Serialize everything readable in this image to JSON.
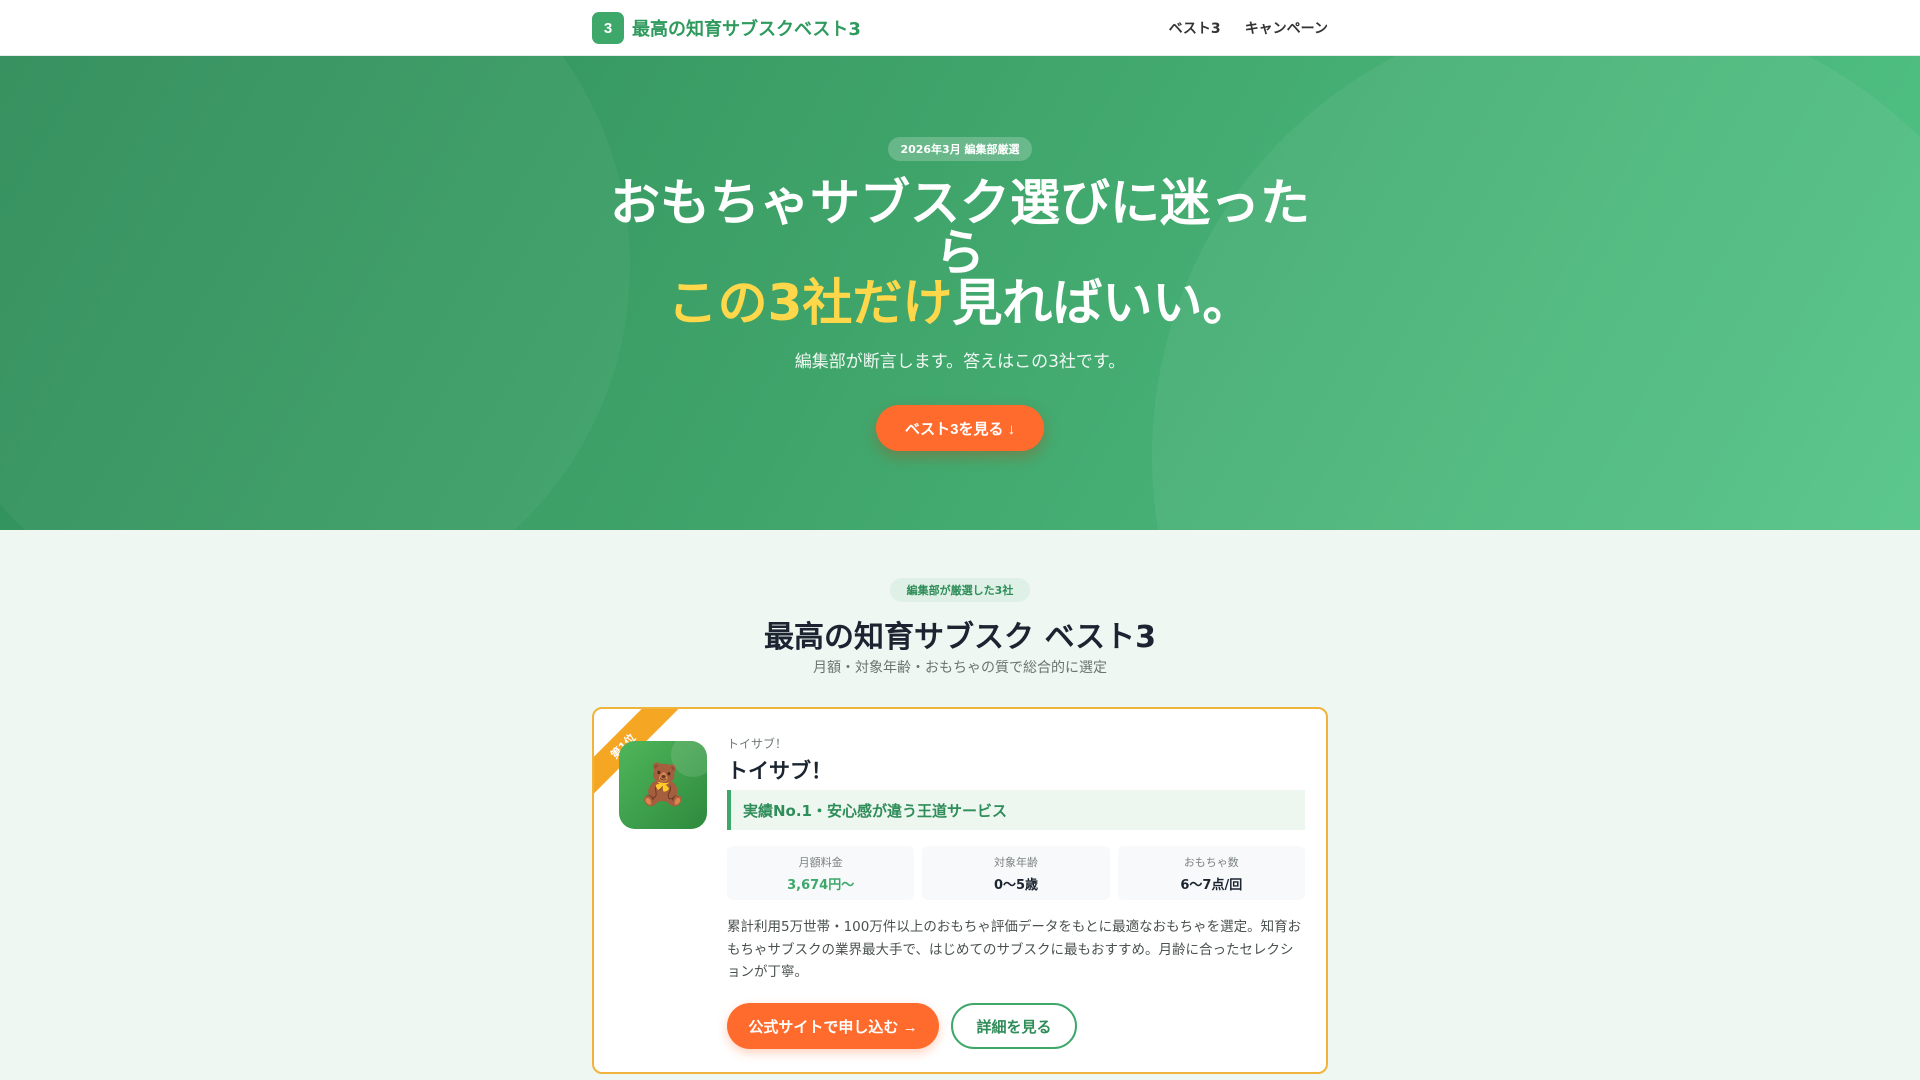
{
  "header": {
    "badge": "3",
    "site_name": "最高の知育サブスクベスト3",
    "nav": [
      {
        "label": "ベスト3"
      },
      {
        "label": "キャンペーン"
      }
    ]
  },
  "hero": {
    "badge": "2026年3月 編集部厳選",
    "title_line1": "おもちゃサブスク選びに迷ったら",
    "title_highlight": "この3社だけ",
    "title_rest": "見ればいい。",
    "subtitle": "編集部が断言します。答えはこの3社です。",
    "cta_label": "ベスト3を見る ↓"
  },
  "ranking": {
    "pill": "編集部が厳選した3社",
    "title": "最高の知育サブスク ベスト3",
    "subtitle": "月額・対象年齢・おもちゃの質で総合的に選定",
    "items": [
      {
        "rank_label": "第1位",
        "logo_icon": "🧸",
        "brand": "トイサブ！",
        "name": "トイサブ！",
        "tagline": "実績No.1・安心感が違う王道サービス",
        "stats": [
          {
            "label": "月額料金",
            "value": "3,674円〜"
          },
          {
            "label": "対象年齢",
            "value": "0〜5歳"
          },
          {
            "label": "おもちゃ数",
            "value": "6〜7点/回"
          }
        ],
        "description": "累計利用5万世帯・100万件以上のおもちゃ評価データをもとに最適なおもちゃを選定。知育おもちゃサブスクの業界最大手で、はじめてのサブスクに最もおすすめ。月齢に合ったセレクションが丁寧。",
        "primary_cta": "公式サイトで申し込む →",
        "secondary_cta": "詳細を見る"
      }
    ]
  },
  "colors": {
    "brand_green": "#3ea86a",
    "accent_orange": "#ff6b2c",
    "highlight_yellow": "#ffd74a",
    "card_border": "#f0b43c"
  }
}
